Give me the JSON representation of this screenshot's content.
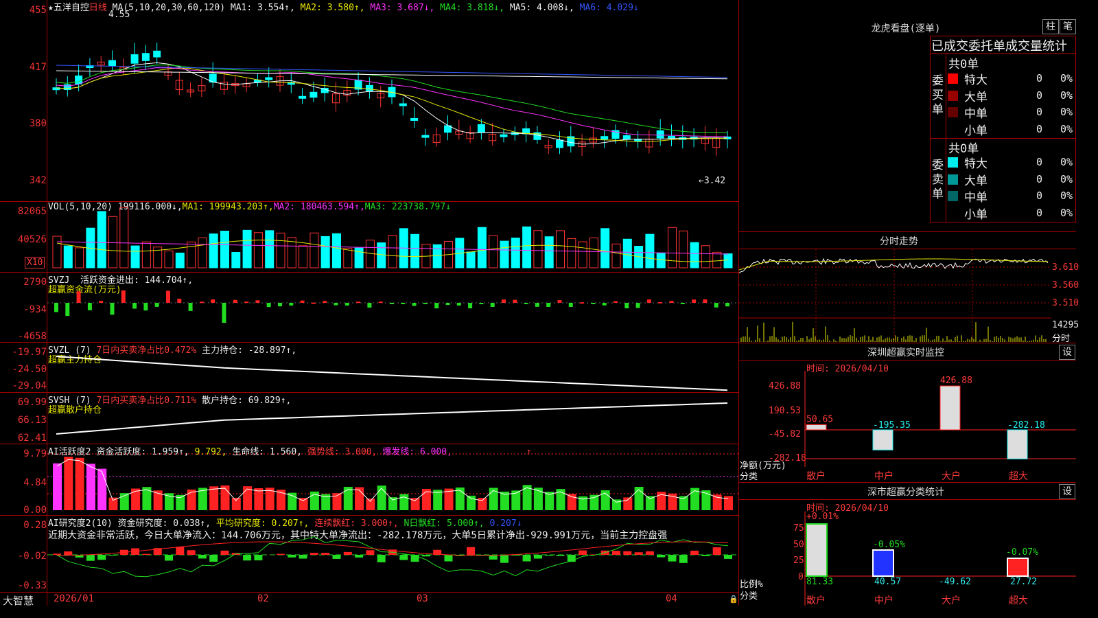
{
  "main": {
    "star_title": "★五洋自控",
    "period": "日线",
    "ma_label": "MA(5,10,20,30,60,120)",
    "ma": [
      {
        "t": "MA1: 3.554↑",
        "c": "wht"
      },
      {
        "t": "MA2: 3.580↑",
        "c": "yel"
      },
      {
        "t": "MA3: 3.687↓",
        "c": "mag"
      },
      {
        "t": "MA4: 3.818↓",
        "c": "grn"
      },
      {
        "t": "MA5: 4.008↓",
        "c": "wht"
      },
      {
        "t": "MA6: 4.029↓",
        "c": "blu"
      }
    ],
    "axis": [
      "455",
      "417",
      "380",
      "342"
    ],
    "high_mark": "4.55",
    "low_mark": "←3.42"
  },
  "vol": {
    "label": "VOL(5,10,20)",
    "vals": [
      {
        "t": "199116.000↓,",
        "c": "wht"
      },
      {
        "t": "MA1: 199943.203↑,",
        "c": "yel"
      },
      {
        "t": "MA2: 180463.594↑,",
        "c": "mag"
      },
      {
        "t": "MA3: 223738.797↓",
        "c": "grn"
      }
    ],
    "axis": [
      "82065",
      "40526"
    ],
    "unit": "X10"
  },
  "svzj": {
    "label": "SVZJ",
    "line1": "活跃资金进出: 144.704↑,",
    "line2": "超赢资金流(万元)",
    "axis": [
      "2790",
      "-934",
      "-4658"
    ]
  },
  "svzl": {
    "label": "SVZL (7)",
    "pct": "7日内买卖净占比0.472%",
    "hold": "主力持仓: -28.897↑,",
    "line2": "超赢主力持仓",
    "axis": [
      "-19.97",
      "-24.50",
      "-29.04"
    ]
  },
  "svsh": {
    "label": "SVSH (7)",
    "pct": "7日内买卖净占比0.711%",
    "hold": "散户持仓: 69.829↑,",
    "line2": "超赢散户持仓",
    "axis": [
      "69.99",
      "66.13",
      "62.41"
    ]
  },
  "ai1": {
    "label": "AI活跃度2",
    "v1": "资金活跃度: 1.959↑,",
    "v2": "9.792,",
    "v3": "生命线: 1.560,",
    "v4": "强势线: 3.000,",
    "v5": "爆发线: 6.000,",
    "v6": "↑",
    "axis": [
      "9.79",
      "4.84",
      "0.00"
    ]
  },
  "ai2": {
    "label": "AI研究度2(10)",
    "v1": "资金研究度: 0.038↑,",
    "v2": "平均研究度: 0.207↑,",
    "v3": "连续飘红: 3.000↑,",
    "v4": "N日飘红: 5.000↑,",
    "v5": "0.207↓",
    "note": "近期大资金非常活跃，今日大单净流入：144.706万元，其中特大单净流出：-282.178万元，大单5日累计净出-929.991万元，当前主力控盘强",
    "axis": [
      "0.28",
      "-0.02",
      "-0.33"
    ]
  },
  "dates": [
    "2026/01",
    "02",
    "03",
    "04"
  ],
  "brand": "大智慧",
  "right": {
    "dragon_title": "龙虎看盘(逐单)",
    "btn_zhu": "柱",
    "btn_bi": "笔",
    "stats_title": "已成交委托单成交量统计",
    "buy_side": "委买单",
    "sell_side": "委卖单",
    "total": "共0单",
    "rows_buy": [
      {
        "name": "特大",
        "n": "0",
        "p": "0%",
        "color": "#ff0000"
      },
      {
        "name": "大单",
        "n": "0",
        "p": "0%",
        "color": "#990000"
      },
      {
        "name": "中单",
        "n": "0",
        "p": "0%",
        "color": "#660000"
      },
      {
        "name": "小单",
        "n": "0",
        "p": "0%",
        "color": "#000000"
      }
    ],
    "rows_sell": [
      {
        "name": "特大",
        "n": "0",
        "p": "0%",
        "color": "#00eeee"
      },
      {
        "name": "大单",
        "n": "0",
        "p": "0%",
        "color": "#009999"
      },
      {
        "name": "中单",
        "n": "0",
        "p": "0%",
        "color": "#006666"
      },
      {
        "name": "小单",
        "n": "0",
        "p": "0%",
        "color": "#000000"
      }
    ],
    "fenshi_title": "分时走势",
    "fenshi_axis": [
      "3.610",
      "3.560",
      "3.510"
    ],
    "fenshi_vol": "14295",
    "fenshi_label": "分时",
    "sz_title": "深圳超赢实时监控",
    "sz_btn": "设",
    "sz_time": "时间: 2026/04/10",
    "sz_axis": [
      "426.88",
      "190.53",
      "-45.82",
      "-282.18"
    ],
    "sz_ylabel": "净额(万元)",
    "sz_xlabel": "分类",
    "sz_cats": [
      "散户",
      "中户",
      "大户",
      "超大"
    ],
    "sz_vals": [
      "50.65",
      "-195.35",
      "426.88",
      "-282.18"
    ],
    "ss_title": "深市超赢分类统计",
    "ss_btn": "设",
    "ss_time": "时间: 2026/04/10",
    "ss_axis": [
      "75",
      "50",
      "25",
      "0"
    ],
    "ss_ylabel": "比例%",
    "ss_xlabel": "分类",
    "ss_cats": [
      "散户",
      "中户",
      "大户",
      "超大"
    ],
    "ss_top": [
      "+0.01%",
      "-0.05%",
      "",
      "-0.07%"
    ],
    "ss_bottom": [
      "81.33",
      "40.57",
      "-49.62",
      "27.72"
    ]
  }
}
